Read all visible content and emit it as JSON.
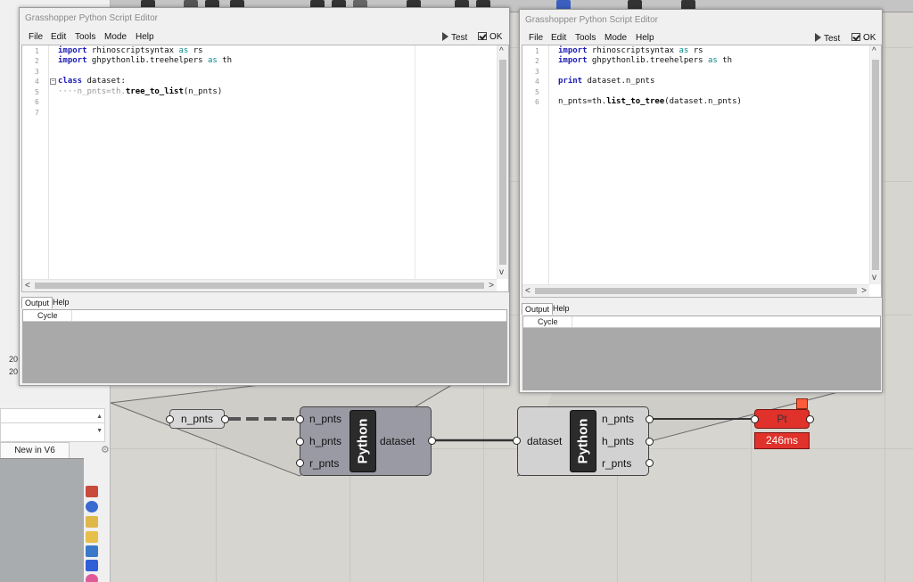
{
  "left_panel": {
    "row_values": [
      "20",
      "20"
    ],
    "tab_label": "New in V6"
  },
  "canvas": {
    "panel_param": "n_pnts",
    "python1": {
      "inputs": [
        "n_pnts",
        "h_pnts",
        "r_pnts"
      ],
      "name": "Python",
      "output": "dataset"
    },
    "python2": {
      "input": "dataset",
      "name": "Python",
      "outputs": [
        "n_pnts",
        "h_pnts",
        "r_pnts"
      ]
    },
    "pt_component": {
      "label": "Pt",
      "timing": "246ms",
      "color": "#e0312b"
    }
  },
  "editor1": {
    "title": "Grasshopper Python Script Editor",
    "menu": [
      "File",
      "Edit",
      "Tools",
      "Mode",
      "Help"
    ],
    "test_label": "Test",
    "ok_label": "OK",
    "line_numbers": [
      "1",
      "2",
      "3",
      "4",
      "5",
      "6",
      "7"
    ],
    "code": {
      "l1_kw": "import",
      "l1_rest": " rhinoscriptsyntax ",
      "l1_as": "as",
      "l1_alias": " rs",
      "l2_kw": "import",
      "l2_rest": " ghpythonlib.treehelpers ",
      "l2_as": "as",
      "l2_alias": " th",
      "l4_kw": "class",
      "l4_rest": " dataset:",
      "l5_pre": "····n_pnts=th.",
      "l5_fn": "tree_to_list",
      "l5_post": "(n_pnts)"
    },
    "output_tabs": [
      "Output",
      "Help"
    ],
    "output_column": "Cycle"
  },
  "editor2": {
    "title": "Grasshopper Python Script Editor",
    "menu": [
      "File",
      "Edit",
      "Tools",
      "Mode",
      "Help"
    ],
    "test_label": "Test",
    "ok_label": "OK",
    "line_numbers": [
      "1",
      "2",
      "3",
      "4",
      "5",
      "6"
    ],
    "code": {
      "l1_kw": "import",
      "l1_rest": " rhinoscriptsyntax ",
      "l1_as": "as",
      "l1_alias": " rs",
      "l2_kw": "import",
      "l2_rest": " ghpythonlib.treehelpers ",
      "l2_as": "as",
      "l2_alias": " th",
      "l4_kw": "print",
      "l4_rest": " dataset.n_pnts",
      "l6_pre": "n_pnts=th.",
      "l6_fn": "list_to_tree",
      "l6_post": "(dataset.n_pnts)"
    },
    "output_tabs": [
      "Output",
      "Help"
    ],
    "output_column": "Cycle"
  },
  "colors": {
    "keyword": "#1a1ab4",
    "component_gray": "#9a9aa5",
    "python_box": "#2b2b2b"
  }
}
